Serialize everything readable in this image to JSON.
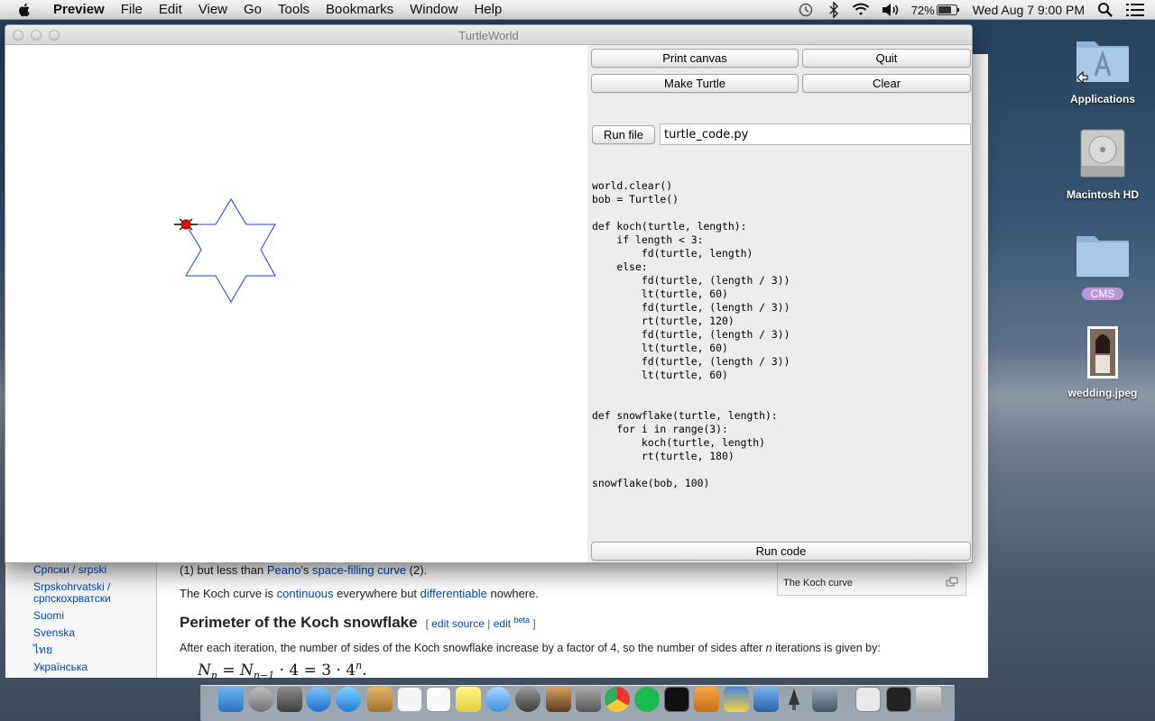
{
  "menubar": {
    "app_name": "Preview",
    "items": [
      "File",
      "Edit",
      "View",
      "Go",
      "Tools",
      "Bookmarks",
      "Window",
      "Help"
    ],
    "battery": "72%",
    "datetime": "Wed Aug 7  9:00 PM"
  },
  "window": {
    "title": "TurtleWorld",
    "buttons": {
      "print_canvas": "Print canvas",
      "quit": "Quit",
      "make_turtle": "Make Turtle",
      "clear": "Clear",
      "run_file": "Run file",
      "run_code": "Run code"
    },
    "file_input_value": "turtle_code.py",
    "code": "world.clear()\nbob = Turtle()\n\ndef koch(turtle, length):\n    if length < 3:\n        fd(turtle, length)\n    else:\n        fd(turtle, (length / 3))\n        lt(turtle, 60)\n        fd(turtle, (length / 3))\n        rt(turtle, 120)\n        fd(turtle, (length / 3))\n        lt(turtle, 60)\n        fd(turtle, (length / 3))\n        lt(turtle, 60)\n\n\ndef snowflake(turtle, length):\n    for i in range(3):\n        koch(turtle, length)\n        rt(turtle, 180)\n\nsnowflake(bob, 100)"
  },
  "desktop_icons": {
    "applications": "Applications",
    "macintosh_hd": "Macintosh HD",
    "cms": "CMS",
    "wedding": "wedding.jpeg"
  },
  "wiki": {
    "languages": [
      "Српски / srpski",
      "Srpskohrvatski / српскохрватски",
      "Suomi",
      "Svenska",
      "ไทย",
      "Українська"
    ],
    "line1_a": "(1) but less than ",
    "line1_link1": "Peano",
    "line1_b": "'s ",
    "line1_link2": "space-filling curve",
    "line1_c": " (2).",
    "line2_a": "The Koch curve is ",
    "line2_link1": "continuous",
    "line2_b": " everywhere but ",
    "line2_link2": "differentiable",
    "line2_c": " nowhere.",
    "heading": "Perimeter of the Koch snowflake",
    "edit_source": "edit source",
    "edit": "edit",
    "beta": "beta",
    "para": "After each iteration, the number of sides of the Koch snowflake increase by a factor of 4, so the number of sides after ",
    "para_n": "n",
    "para_end": " iterations is given by:",
    "caption": "The Koch curve"
  },
  "colors": {
    "turtle": "#e01010",
    "drawing": "#1f3fd0",
    "link": "#0645ad"
  }
}
